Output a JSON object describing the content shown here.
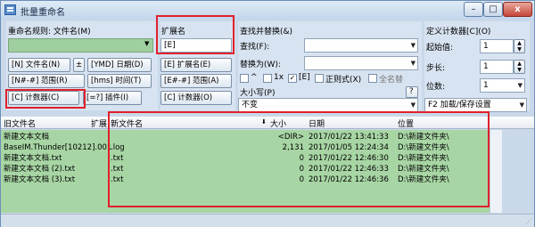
{
  "window": {
    "title": "批量重命名",
    "min": "–",
    "max": "□",
    "close": "x"
  },
  "rename": {
    "label": "重命名规则: 文件名(M)",
    "name_value": "",
    "buttons": [
      "[N] 文件名(N)",
      "±",
      "[YMD] 日期(D)",
      "[N#-#] 范围(R)",
      "[hms] 时间(T)",
      "[C] 计数器(C)",
      "[=?] 插件(I)"
    ]
  },
  "ext": {
    "label": "扩展名",
    "value": "[E]",
    "buttons": [
      "[E] 扩展名(E)",
      "[E#-#] 范围(A)",
      "[C] 计数器(O)"
    ]
  },
  "find": {
    "label": "查找并替换(&)",
    "find_label": "查找(F):",
    "replace_label": "替换为(W):",
    "options": [
      "^",
      "1x",
      "[E]",
      "正则式(X)",
      "全名替"
    ],
    "case_label": "大小写(P)",
    "case_value": "不变",
    "help": "?"
  },
  "counter": {
    "label": "定义计数器[C](O)",
    "start_label": "起始值:",
    "start_value": "1",
    "step_label": "步长:",
    "step_value": "1",
    "digits_label": "位数:",
    "digits_value": "1",
    "load_save": "F2 加载/保存设置"
  },
  "columns": [
    "旧文件名",
    "扩展",
    "新文件名",
    "大小",
    "日期",
    "位置"
  ],
  "rows": [
    {
      "old": "新建文本文档",
      "ext": "",
      "new": "",
      "size": "<DIR>",
      "date": "2017/01/22 13:41:33",
      "loc": "D:\\新建文件夹\\"
    },
    {
      "old": "BaseIM.Thunder[10212].001",
      "ext": "log",
      "new": ".log",
      "size": "2,131",
      "date": "2017/01/05 12:24:34",
      "loc": "D:\\新建文件夹\\"
    },
    {
      "old": "新建文本文档.txt",
      "ext": "txt",
      "new": ".txt",
      "size": "0",
      "date": "2017/01/22 12:46:30",
      "loc": "D:\\新建文件夹\\"
    },
    {
      "old": "新建文本文档 (2).txt",
      "ext": "txt",
      "new": ".txt",
      "size": "0",
      "date": "2017/01/22 12:46:33",
      "loc": "D:\\新建文件夹\\"
    },
    {
      "old": "新建文本文档 (3).txt",
      "ext": "txt",
      "new": ".txt",
      "size": "0",
      "date": "2017/01/22 12:46:36",
      "loc": "D:\\新建文件夹\\"
    }
  ],
  "colors": {
    "list_bg": "#a7d5a4",
    "highlight": "#e0202a"
  }
}
